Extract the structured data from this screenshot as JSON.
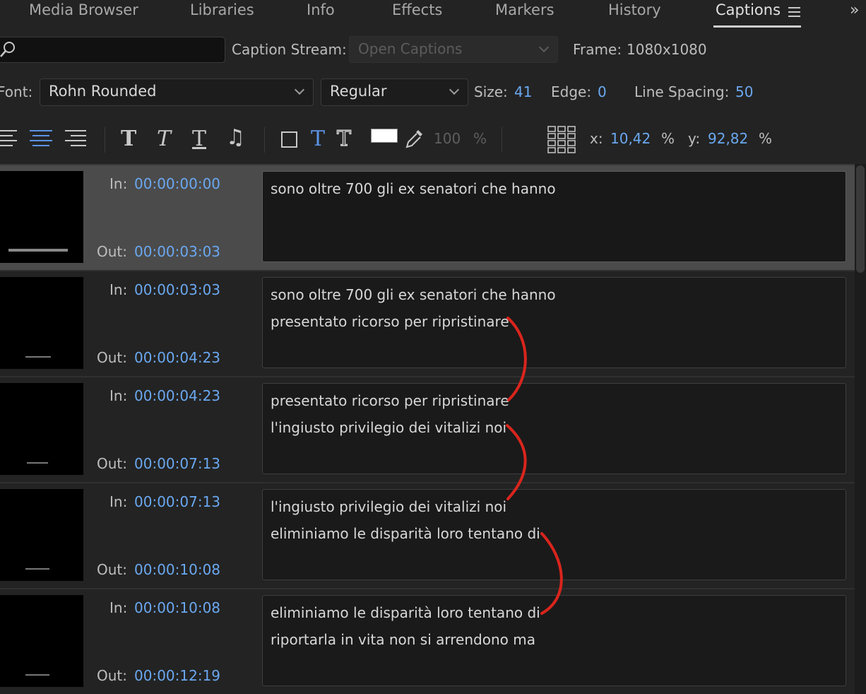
{
  "tabs": [
    {
      "label": "Media Browser"
    },
    {
      "label": "Libraries"
    },
    {
      "label": "Info"
    },
    {
      "label": "Effects"
    },
    {
      "label": "Markers"
    },
    {
      "label": "History"
    },
    {
      "label": "Captions",
      "active": true
    }
  ],
  "more_label": "»",
  "stream": {
    "label": "Caption Stream:",
    "value": "Open Captions"
  },
  "frame": {
    "label": "Frame:",
    "value": "1080x1080"
  },
  "font": {
    "label": "Font:",
    "value": "Rohn Rounded",
    "style": "Regular"
  },
  "size": {
    "label": "Size:",
    "value": "41"
  },
  "edge": {
    "label": "Edge:",
    "value": "0"
  },
  "line_spacing": {
    "label": "Line Spacing:",
    "value": "50"
  },
  "toolbar": {
    "opacity_value": "100",
    "opacity_unit": "%",
    "bold_glyph": "T",
    "italic_glyph": "T",
    "underline_glyph": "T",
    "text_glyph": "T",
    "text_outline_glyph": "T",
    "note_glyph": "♫",
    "x_label": "x:",
    "x_value": "10,42",
    "x_unit": "%",
    "y_label": "y:",
    "y_value": "92,82",
    "y_unit": "%",
    "fill_color": "#ffffff"
  },
  "in_label": "In:",
  "out_label": "Out:",
  "captions": [
    {
      "in": "00:00:00:00",
      "out": "00:00:03:03",
      "lines": [
        "sono oltre 700 gli ex senatori che hanno",
        ""
      ],
      "selected": true
    },
    {
      "in": "00:00:03:03",
      "out": "00:00:04:23",
      "lines": [
        "sono oltre 700 gli ex senatori che hanno",
        "presentato ricorso per ripristinare"
      ]
    },
    {
      "in": "00:00:04:23",
      "out": "00:00:07:13",
      "lines": [
        "presentato ricorso per ripristinare",
        "l'ingiusto privilegio dei vitalizi noi"
      ]
    },
    {
      "in": "00:00:07:13",
      "out": "00:00:10:08",
      "lines": [
        "l'ingiusto privilegio dei vitalizi noi",
        "eliminiamo le disparità loro tentano di"
      ]
    },
    {
      "in": "00:00:10:08",
      "out": "00:00:12:19",
      "lines": [
        "eliminiamo le disparità loro tentano di",
        "riportarla in vita non si arrendono ma"
      ]
    }
  ],
  "colors": {
    "accent": "#6aa8f0",
    "annotation": "#d9251d"
  }
}
